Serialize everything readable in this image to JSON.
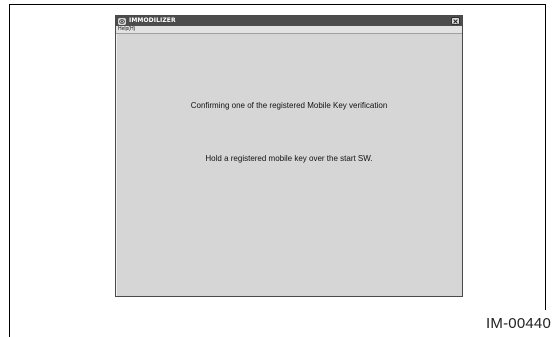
{
  "window": {
    "title": "IMMODILIZER",
    "app_icon": "car-key-icon",
    "close_icon": "close-icon"
  },
  "menu": {
    "items": [
      {
        "label": "Help(H)"
      }
    ]
  },
  "content": {
    "message_primary": "Confirming one of the registered Mobile Key verification",
    "message_instruction": "Hold a registered mobile key over the start SW."
  },
  "figure": {
    "id": "IM-00440"
  }
}
